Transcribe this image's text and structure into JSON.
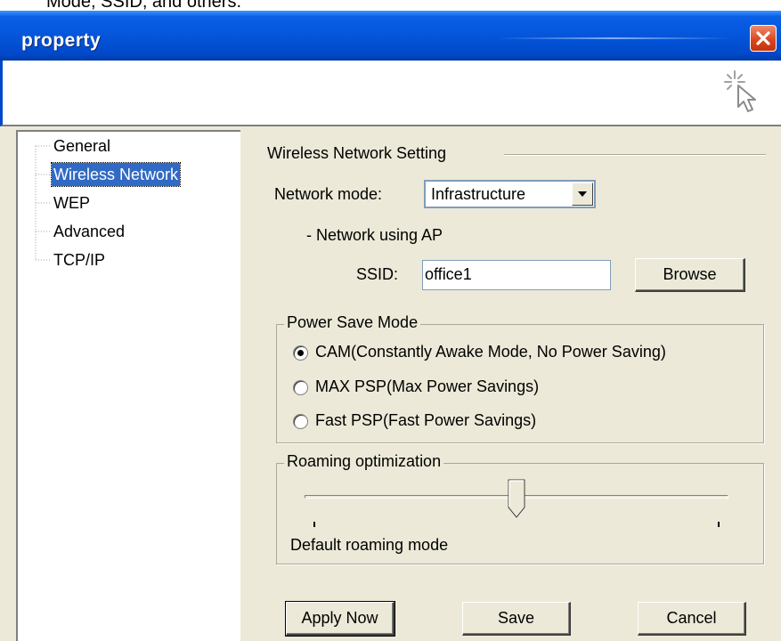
{
  "doc_caption": "Mode, SSID, and others.",
  "window": {
    "title": "property"
  },
  "sidebar": {
    "items": [
      {
        "label": "General",
        "selected": false
      },
      {
        "label": "Wireless Network",
        "selected": true
      },
      {
        "label": "WEP",
        "selected": false
      },
      {
        "label": "Advanced",
        "selected": false
      },
      {
        "label": "TCP/IP",
        "selected": false
      }
    ]
  },
  "main": {
    "section_title": "Wireless Network Setting",
    "network_mode": {
      "label": "Network mode:",
      "value": "Infrastructure",
      "note": "- Network using AP"
    },
    "ssid": {
      "label": "SSID:",
      "value": "office1",
      "browse_label": "Browse"
    },
    "power_save": {
      "legend": "Power Save Mode",
      "options": [
        {
          "label": "CAM(Constantly Awake Mode, No Power Saving)",
          "checked": true
        },
        {
          "label": "MAX PSP(Max Power Savings)",
          "checked": false
        },
        {
          "label": "Fast PSP(Fast Power Savings)",
          "checked": false
        }
      ]
    },
    "roaming": {
      "legend": "Roaming optimization",
      "slider_fraction": 0.5,
      "value_label": "Default roaming mode"
    },
    "buttons": {
      "apply": "Apply Now",
      "save": "Save",
      "cancel": "Cancel"
    }
  },
  "colors": {
    "title_bar": "#0454d8",
    "selection": "#316ac5",
    "dialog_face": "#ece9d8",
    "close_button": "#d8441e"
  },
  "icons": [
    "close-icon",
    "wizard-cursor-icon",
    "dropdown-arrow-icon"
  ]
}
